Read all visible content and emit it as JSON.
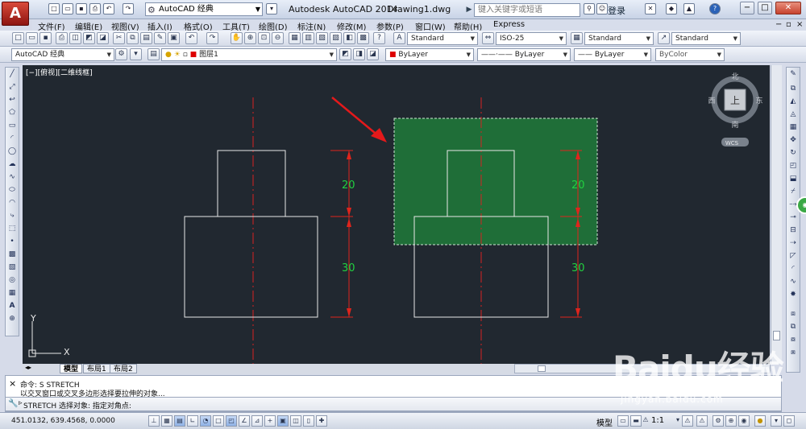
{
  "title_bar": {
    "app_logo": "A",
    "workspace": "AutoCAD 经典",
    "app_title": "Autodesk AutoCAD 2014",
    "doc_title": "Drawing1.dwg",
    "search_placeholder": "键入关键字或短语",
    "login": "登录",
    "help": "?"
  },
  "menus": [
    "文件(F)",
    "编辑(E)",
    "视图(V)",
    "插入(I)",
    "格式(O)",
    "工具(T)",
    "绘图(D)",
    "标注(N)",
    "修改(M)",
    "参数(P)",
    "窗口(W)",
    "帮助(H)",
    "Express"
  ],
  "styles_toolbar": {
    "text_style": "Standard",
    "dim_style": "ISO-25",
    "table_style": "Standard",
    "mleader_style": "Standard"
  },
  "layers_toolbar": {
    "workspace": "AutoCAD 经典",
    "layer": "图层1",
    "color": "ByLayer",
    "linetype": "ByLayer",
    "lineweight": "ByLayer",
    "plotstyle": "ByColor"
  },
  "viewport": {
    "label": "[−][俯视][二维线框]",
    "viewcube": {
      "north": "北",
      "south": "南",
      "east": "东",
      "west": "西",
      "top": "上",
      "wcs": "WCS"
    },
    "ucs": {
      "x": "X",
      "y": "Y"
    },
    "dims": {
      "upper": "20",
      "lower": "30"
    }
  },
  "colors": {
    "canvas": "#212830",
    "geometry": "#e8e8e8",
    "centerline": "#d62222",
    "dimension": "#e0241c",
    "dim_text": "#22d040",
    "selection_fill": "#1f7a3a",
    "arrow": "#e4191b"
  },
  "layout_tabs": [
    "模型",
    "布局1",
    "布局2"
  ],
  "command": {
    "line1": "命令: S STRETCH",
    "line2": "以交叉窗口或交叉多边形选择要拉伸的对象...",
    "input": "STRETCH 选择对象: 指定对角点:"
  },
  "status": {
    "coords": "451.0132, 639.4568, 0.0000",
    "model": "模型",
    "scale": "1:1"
  },
  "watermark": {
    "main": "Baidu经验",
    "sub": "jingyan.baidu.com"
  }
}
